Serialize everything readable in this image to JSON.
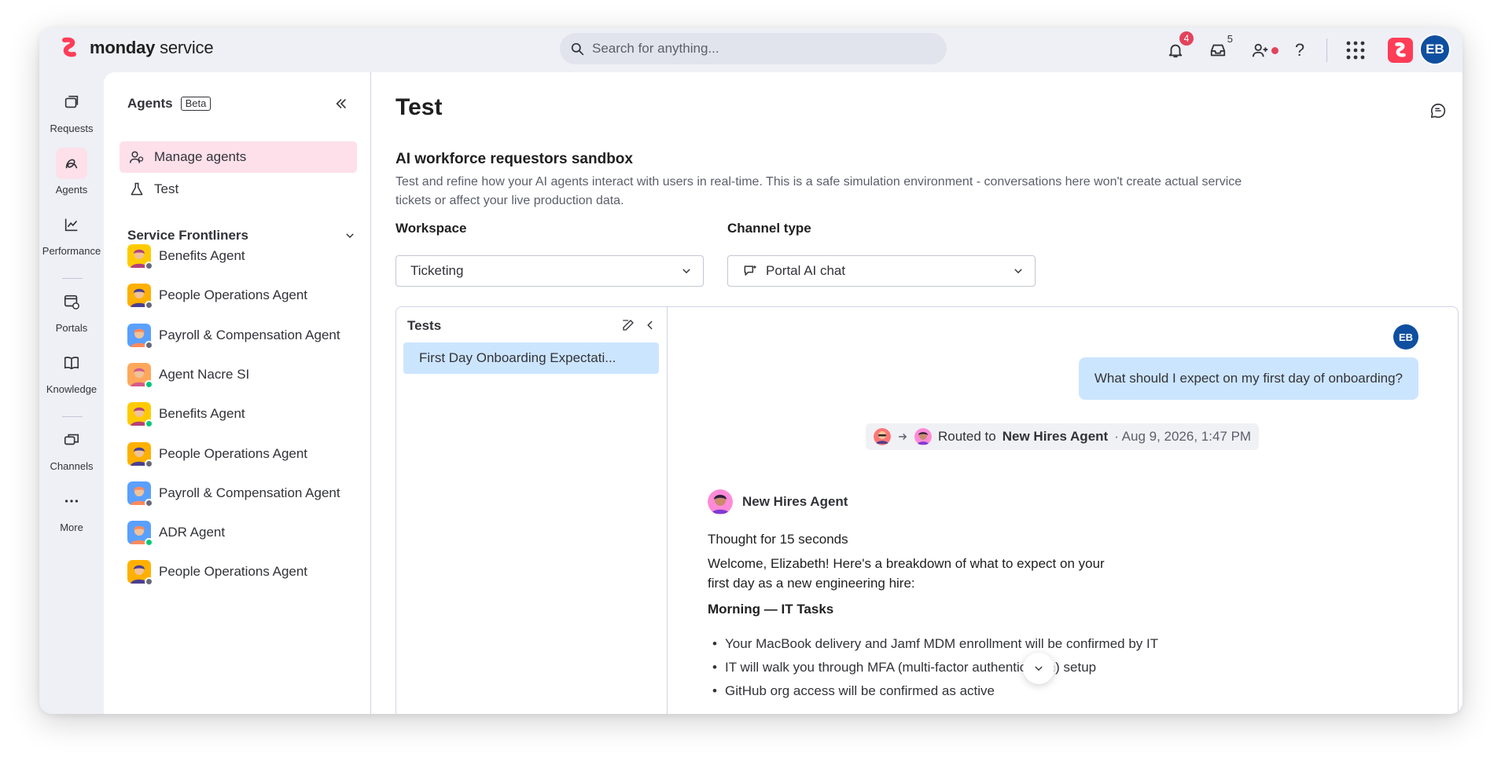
{
  "app": {
    "brand_bold": "monday",
    "brand_rest": " service",
    "brand_color": "#ff3d57"
  },
  "topbar": {
    "search_placeholder": "Search for anything...",
    "notifications_count": "4",
    "inbox_count": "5",
    "user_initials": "EB"
  },
  "rail": {
    "items": [
      {
        "label": "Requests",
        "icon": "requests-icon"
      },
      {
        "label": "Agents",
        "icon": "agents-icon"
      },
      {
        "label": "Performance",
        "icon": "chart-icon"
      },
      {
        "label": "Portals",
        "icon": "portal-icon"
      },
      {
        "label": "Knowledge",
        "icon": "book-icon"
      },
      {
        "label": "Channels",
        "icon": "channels-icon"
      },
      {
        "label": "More",
        "icon": "more-icon"
      }
    ]
  },
  "sidebar": {
    "title": "Agents",
    "beta": "Beta",
    "nav": [
      {
        "label": "Manage agents"
      },
      {
        "label": "Test"
      }
    ],
    "section_title": "Service Frontliners",
    "agents": [
      {
        "name": "Benefits Agent",
        "status": "offline"
      },
      {
        "name": "People Operations Agent",
        "status": "offline"
      },
      {
        "name": "Payroll & Compensation Agent",
        "status": "offline"
      },
      {
        "name": "Agent Nacre SI",
        "status": "online"
      },
      {
        "name": "Benefits Agent",
        "status": "online"
      },
      {
        "name": "People Operations Agent",
        "status": "offline"
      },
      {
        "name": "Payroll & Compensation Agent",
        "status": "offline"
      },
      {
        "name": "ADR Agent",
        "status": "online"
      },
      {
        "name": "People Operations Agent",
        "status": "offline"
      }
    ]
  },
  "main": {
    "title": "Test",
    "sandbox_title": "AI workforce requestors sandbox",
    "sandbox_desc": "Test and refine how your AI agents interact with users in real-time. This is a safe simulation environment - conversations here won't create actual service tickets or affect your live production data.",
    "workspace_label": "Workspace",
    "workspace_value": "Ticketing",
    "channel_label": "Channel type",
    "channel_value": "Portal AI chat"
  },
  "tests": {
    "title": "Tests",
    "items": [
      "First Day Onboarding Expectati..."
    ]
  },
  "chat": {
    "user_initials": "EB",
    "user_message": "What should I expect on my first day of onboarding?",
    "route_prefix": "Routed to",
    "route_agent": "New Hires Agent",
    "route_time": "· Aug 9, 2026, 1:47 PM",
    "agent_name": "New Hires Agent",
    "thought": "Thought for 15 seconds",
    "welcome": "Welcome, Elizabeth! Here's a breakdown of what to expect on your first day as a new engineering hire:",
    "section_heading": "Morning — IT Tasks",
    "bullets": [
      "Your MacBook delivery and Jamf MDM enrollment will be confirmed by IT",
      "IT will walk you through MFA (multi-factor authentication) setup",
      "GitHub org access will be confirmed as active"
    ]
  },
  "colors": {
    "accent_pink": "#ff3d57",
    "selected_blue": "#cce5ff",
    "active_nav": "#fde0ea",
    "online": "#00c875",
    "offline": "#676879",
    "avatar_blue": "#0f4fa0"
  }
}
